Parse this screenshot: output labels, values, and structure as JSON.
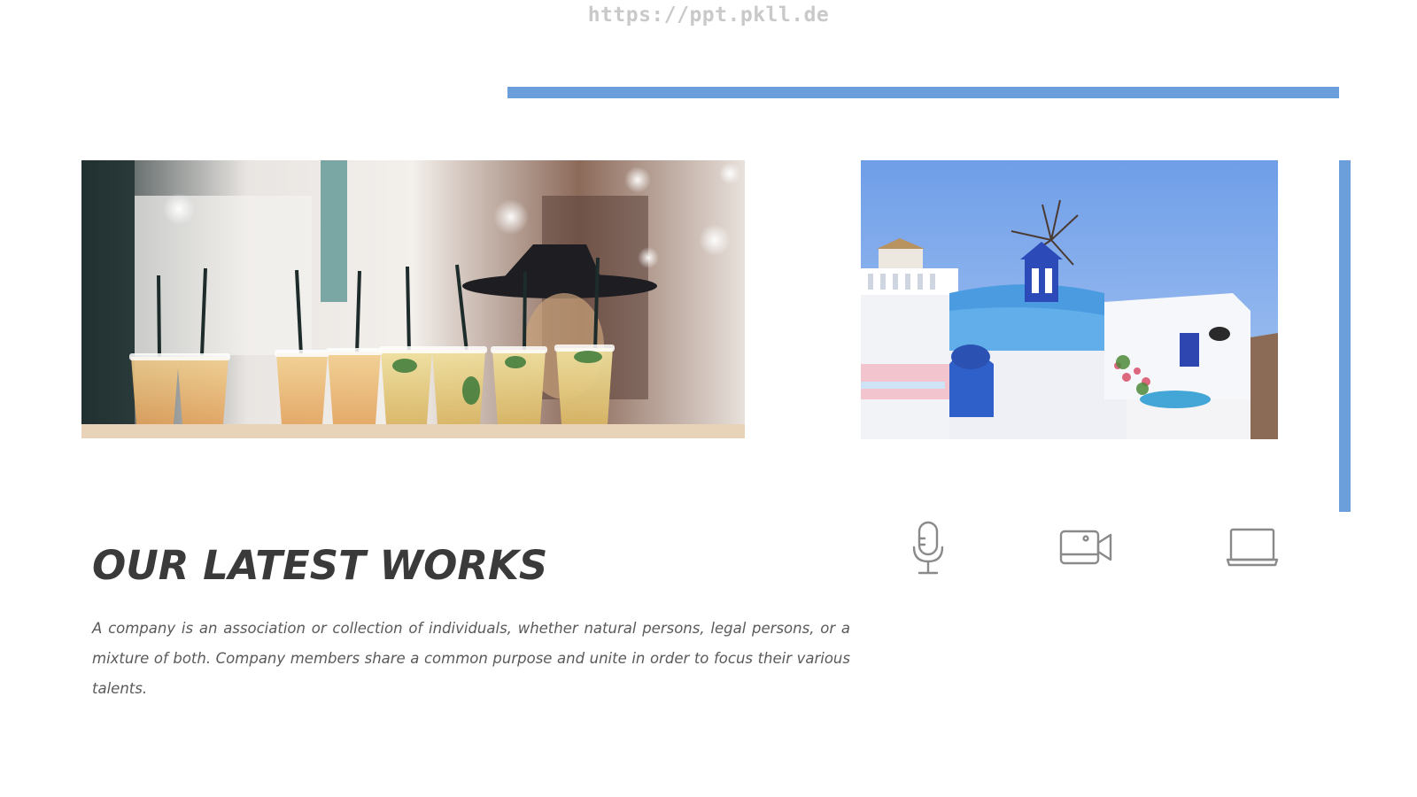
{
  "watermark": "https://ppt.pkll.de",
  "section": {
    "title": "OUR LATEST WORKS",
    "body": "A company is an association or collection of individuals, whether natural persons, legal persons, or a mixture of both. Company members share a common purpose and unite in order to focus their various talents."
  },
  "icons": [
    "microphone-icon",
    "video-camera-icon",
    "laptop-icon"
  ],
  "colors": {
    "accent": "#6a9fdb",
    "icon_stroke": "#8a8a8a",
    "title": "#3a3a3a",
    "body": "#5a5a5a",
    "watermark": "#c9c9c9"
  }
}
